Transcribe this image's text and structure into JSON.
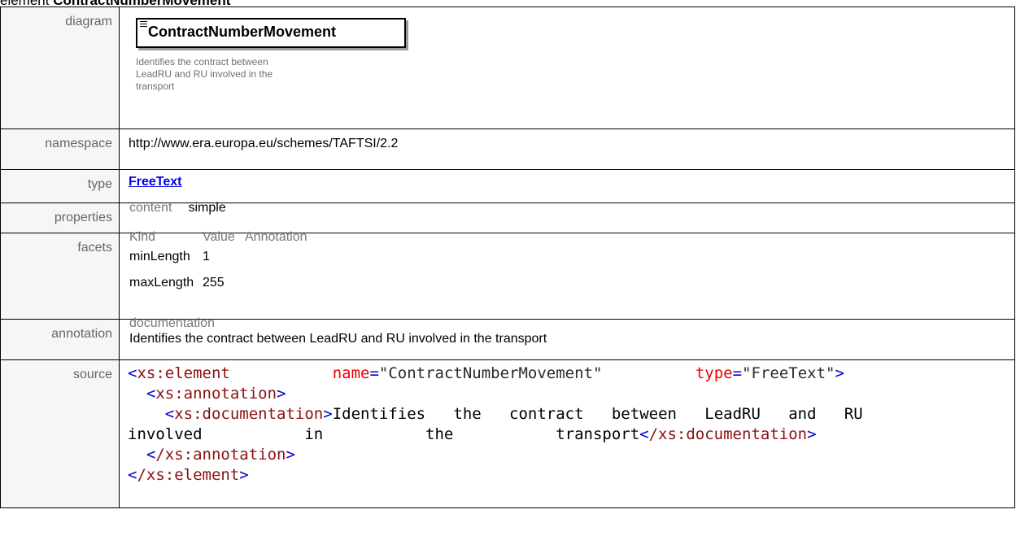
{
  "header": {
    "prefix": "element",
    "title": "ContractNumberMovement"
  },
  "labels": {
    "diagram": "diagram",
    "namespace": "namespace",
    "type": "type",
    "properties": "properties",
    "facets": "facets",
    "annotation": "annotation",
    "source": "source"
  },
  "diagram": {
    "element_name": "ContractNumberMovement",
    "doc": "Identifies the contract between LeadRU and RU involved in the transport"
  },
  "namespace": "http://www.era.europa.eu/schemes/TAFTSI/2.2",
  "type": "FreeText",
  "properties": {
    "key": "content",
    "value": "simple"
  },
  "facets": {
    "headers": [
      "Kind",
      "Value",
      "Annotation"
    ],
    "rows": [
      {
        "kind": "minLength",
        "value": "1"
      },
      {
        "kind": "maxLength",
        "value": "255"
      }
    ]
  },
  "annotation": {
    "key": "documentation",
    "text": "Identifies the contract between LeadRU and RU involved in the transport"
  },
  "source": {
    "open_tag": "xs:element",
    "attr1_name": "name",
    "attr1_value": "\"ContractNumberMovement\"",
    "attr2_name": "type",
    "attr2_value": "\"FreeText\"",
    "annotation_tag": "xs:annotation",
    "documentation_tag": "xs:documentation",
    "doc_line1": "Identifies   the   contract   between   LeadRU   and   RU",
    "doc_line2": "involved           in           the           transport",
    "close_annotation": "/xs:annotation",
    "close_element": "/xs:element",
    "close_documentation": "/xs:documentation"
  }
}
